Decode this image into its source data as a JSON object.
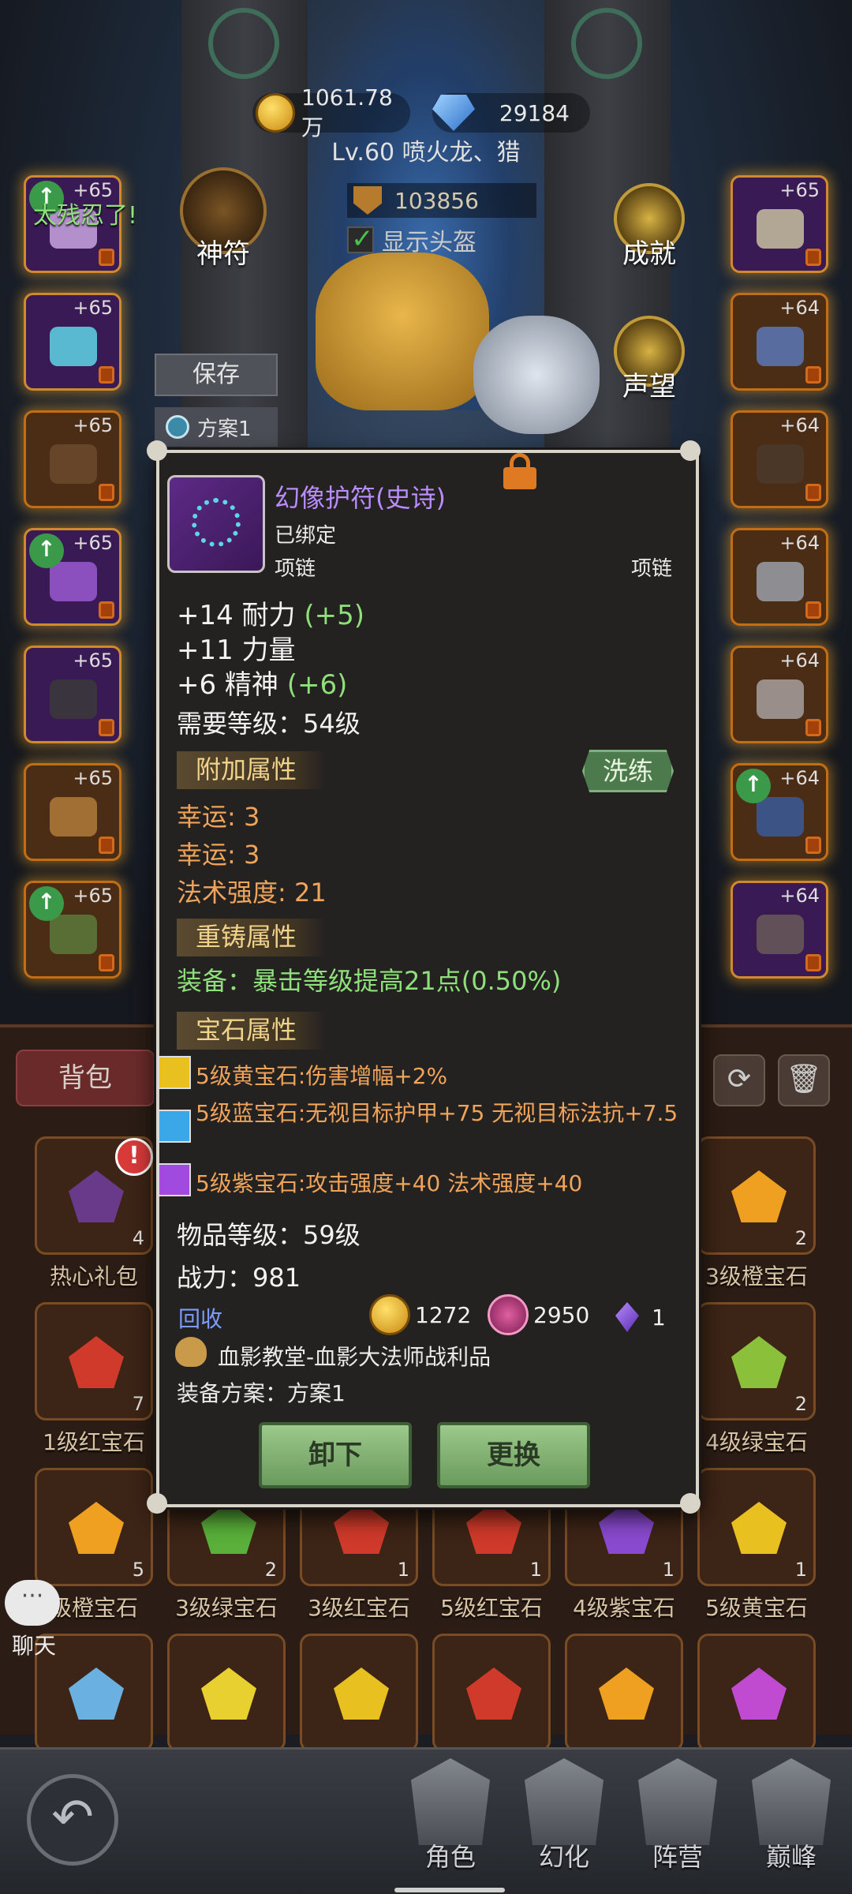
{
  "header": {
    "gold": "1061.78万",
    "gems": "29184",
    "level_name": "Lv.60 喷火龙、猎",
    "power": "103856",
    "show_helmet_label": "显示头盔",
    "notice": "太残忍了!"
  },
  "left_panel": {
    "rune_label": "神符",
    "save_label": "保存",
    "plan_label": "方案1"
  },
  "right_panel": {
    "achievement_label": "成就",
    "reputation_label": "声望"
  },
  "equip_left": [
    {
      "plus": "+65",
      "upgrade": true
    },
    {
      "plus": "+65",
      "upgrade": false
    },
    {
      "plus": "+65",
      "upgrade": false
    },
    {
      "plus": "+65",
      "upgrade": true
    },
    {
      "plus": "+65",
      "upgrade": false
    },
    {
      "plus": "+65",
      "upgrade": false
    },
    {
      "plus": "+65",
      "upgrade": true
    }
  ],
  "equip_right": [
    {
      "plus": "+65",
      "upgrade": false
    },
    {
      "plus": "+64",
      "upgrade": false
    },
    {
      "plus": "+64",
      "upgrade": false
    },
    {
      "plus": "+64",
      "upgrade": false
    },
    {
      "plus": "+64",
      "upgrade": false
    },
    {
      "plus": "+64",
      "upgrade": true
    },
    {
      "plus": "+64",
      "upgrade": false
    }
  ],
  "bag": {
    "tab_label": "背包",
    "refresh_icon": "refresh-icon",
    "trash_icon": "trash-icon",
    "row1": [
      {
        "name": "热心礼包",
        "count": "4",
        "color": "#6a3a8a"
      },
      {
        "name": "3级橙宝石",
        "count": "2",
        "color": "#f0a020"
      }
    ],
    "row2": [
      {
        "name": "1级红宝石",
        "count": "7",
        "color": "#d03a2a"
      },
      {
        "name": "4级绿宝石",
        "count": "2",
        "color": "#8ac03a"
      }
    ],
    "row3": [
      {
        "name": "级橙宝石",
        "count": "5",
        "color": "#f0a020"
      },
      {
        "name": "3级绿宝石",
        "count": "2",
        "color": "#5ab03a"
      },
      {
        "name": "3级红宝石",
        "count": "1",
        "color": "#d03a2a"
      },
      {
        "name": "5级红宝石",
        "count": "1",
        "color": "#d03a2a"
      },
      {
        "name": "4级紫宝石",
        "count": "1",
        "color": "#8a4ad0"
      },
      {
        "name": "5级黄宝石",
        "count": "1",
        "color": "#e8c020"
      }
    ],
    "row4_colors": [
      "#6ab0e0",
      "#e8d030",
      "#e8c020",
      "#d03a2a",
      "#f0a020",
      "#c04ad0"
    ]
  },
  "chat": {
    "label": "聊天",
    "bubble": "···"
  },
  "nav": {
    "items": [
      {
        "label": "角色",
        "active": true
      },
      {
        "label": "幻化",
        "active": false
      },
      {
        "label": "阵营",
        "active": false
      },
      {
        "label": "巅峰",
        "active": false
      }
    ]
  },
  "item": {
    "name": "幻像护符(史诗)",
    "bound": "已绑定",
    "type_left": "项链",
    "type_right": "项链",
    "stats": [
      {
        "text": "+14 耐力",
        "bonus": "(+5)"
      },
      {
        "text": "+11 力量",
        "bonus": ""
      },
      {
        "text": "+6 精神",
        "bonus": "(+6)"
      }
    ],
    "required_level": "需要等级：54级",
    "extra_title": "附加属性",
    "wash_label": "洗练",
    "extra_attrs": [
      "幸运: 3",
      "幸运: 3",
      "法术强度: 21"
    ],
    "reforge_title": "重铸属性",
    "reforge_attr": "装备：暴击等级提高21点(0.50%)",
    "gem_title": "宝石属性",
    "gems": [
      {
        "text": "5级黄宝石:伤害增幅+2%",
        "color": "#e8c020"
      },
      {
        "text": "5级蓝宝石:无视目标护甲+75 无视目标法抗+7.5",
        "color": "#3aa8e8"
      },
      {
        "text": "5级紫宝石:攻击强度+40 法术强度+40",
        "color": "#a04ae0"
      }
    ],
    "item_level": "物品等级：59级",
    "combat_power": "战力：981",
    "recycle_label": "回收",
    "recycle_gold": "1272",
    "recycle_pink": "2950",
    "recycle_crystal": "1",
    "source": "血影教堂-血影大法师战利品",
    "plan": "装备方案：方案1",
    "unequip_label": "卸下",
    "replace_label": "更换"
  }
}
